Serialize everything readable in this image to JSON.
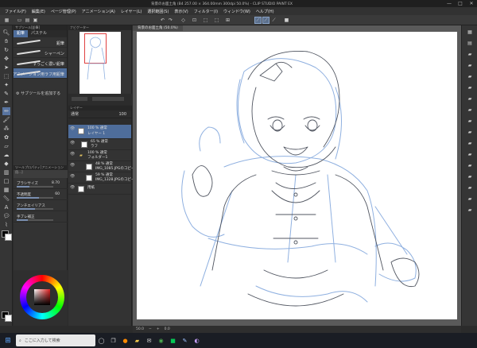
{
  "window": {
    "title": "背景のお面土角 (B4 257.00 × 364.00mm 300dpi 50.0%) - CLIP STUDIO PAINT EX",
    "minimize": "—",
    "maximize": "□",
    "close": "✕"
  },
  "menu": [
    "ファイル(F)",
    "編集(E)",
    "ページ管理(P)",
    "アニメーション(A)",
    "レイヤー(L)",
    "選択範囲(S)",
    "表示(V)",
    "フィルター(I)",
    "ウィンドウ(W)",
    "ヘルプ(H)"
  ],
  "subtool": {
    "header": "サブツール[鉛筆]",
    "tabs": [
      "鉛筆",
      "パステル"
    ],
    "brushes": [
      "鉛筆",
      "シャーペン",
      "すっごく濃い鉛筆",
      "アニメーション用ラフ用鉛筆"
    ],
    "add_label": "サブツールを追加する"
  },
  "tool_property": {
    "header": "ツールプロパティ[アニメーション用…]",
    "rows": [
      {
        "label": "ブラシサイズ",
        "value": "8.70",
        "fraction": 0.35
      },
      {
        "label": "不透明度",
        "value": "60",
        "fraction": 0.6
      },
      {
        "label": "アンチエイリアス",
        "value": "",
        "fraction": 0.5
      },
      {
        "label": "手ブレ補正",
        "value": "",
        "fraction": 0.3
      }
    ]
  },
  "navigator": {
    "header": "ナビゲーター"
  },
  "layers": {
    "header": "レイヤー",
    "blend": "通常",
    "opacity": "100",
    "rows": [
      {
        "name1": "100 % 通常",
        "name2": "レイヤー 1",
        "active": true
      },
      {
        "name1": "65 % 通常",
        "name2": "ラフ",
        "active": false
      },
      {
        "name1": "100 % 通常",
        "name2": "フォルダー1",
        "active": false
      },
      {
        "name1": "48 % 通常",
        "name2": "IMG_1085.JPGのコピー",
        "active": false
      },
      {
        "name1": "59 % 通常",
        "name2": "IMG_1328.JPGのコピー",
        "active": false
      },
      {
        "name1": "用紙",
        "name2": "",
        "active": false
      }
    ]
  },
  "document": {
    "tab": "背景のお面土角 (50.0%)"
  },
  "status": {
    "zoom": "50.0",
    "angle": "0.0"
  },
  "taskbar": {
    "search_placeholder": "ここに入力して検索"
  },
  "colors": {
    "accent": "#4e6d9b",
    "sketch_blue": "#8fb0e0",
    "sketch_dark": "#505560"
  }
}
